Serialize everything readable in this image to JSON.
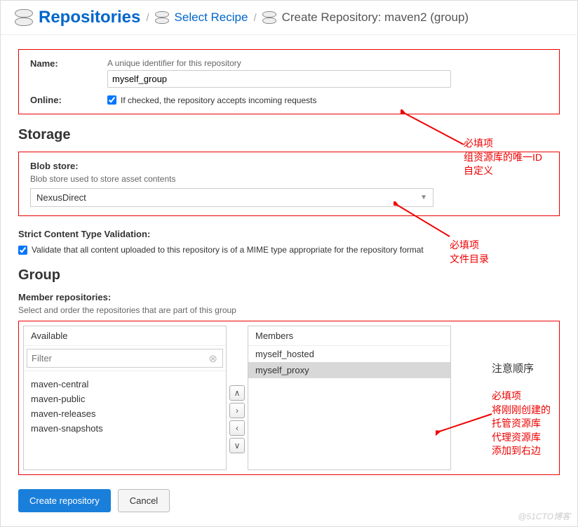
{
  "breadcrumb": {
    "root": "Repositories",
    "step2": "Select Recipe",
    "current": "Create Repository: maven2 (group)"
  },
  "form": {
    "name_label": "Name:",
    "name_hint": "A unique identifier for this repository",
    "name_value": "myself_group",
    "online_label": "Online:",
    "online_hint": "If checked, the repository accepts incoming requests",
    "online_checked": true
  },
  "storage": {
    "title": "Storage",
    "blob_label": "Blob store:",
    "blob_hint": "Blob store used to store asset contents",
    "blob_value": "NexusDirect",
    "strict_label": "Strict Content Type Validation:",
    "strict_hint": "Validate that all content uploaded to this repository is of a MIME type appropriate for the repository format",
    "strict_checked": true
  },
  "group": {
    "title": "Group",
    "member_label": "Member repositories:",
    "member_hint": "Select and order the repositories that are part of this group",
    "available_title": "Available",
    "members_title": "Members",
    "filter_placeholder": "Filter",
    "available": [
      "maven-central",
      "maven-public",
      "maven-releases",
      "maven-snapshots"
    ],
    "members": [
      {
        "name": "myself_hosted",
        "selected": false
      },
      {
        "name": "myself_proxy",
        "selected": true
      }
    ]
  },
  "buttons": {
    "create": "Create repository",
    "cancel": "Cancel"
  },
  "annotations": {
    "a1_l1": "必填项",
    "a1_l2": "组资源库的唯一ID",
    "a1_l3": "自定义",
    "a2_l1": "必填项",
    "a2_l2": "文件目录",
    "a3": "注意顺序",
    "a4_l1": "必填项",
    "a4_l2": "将刚刚创建的",
    "a4_l3": "托管资源库",
    "a4_l4": "代理资源库",
    "a4_l5": "添加到右边"
  },
  "watermark": "@51CTO博客"
}
